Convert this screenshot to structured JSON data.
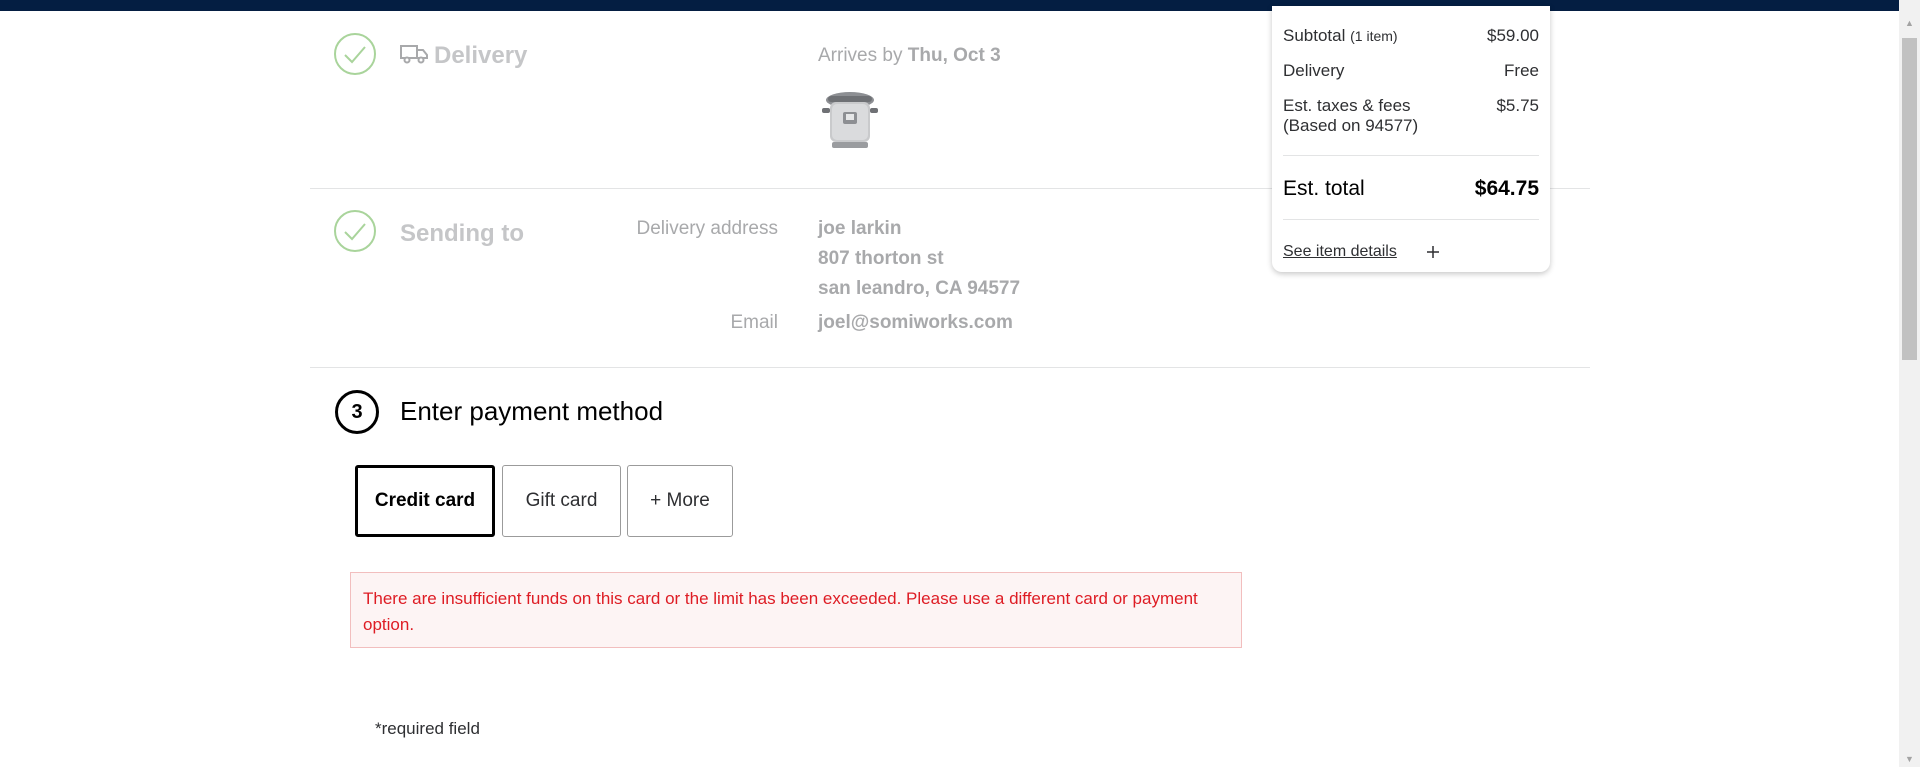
{
  "delivery": {
    "title": "Delivery",
    "arrives_prefix": "Arrives by",
    "arrives_date": "Thu, Oct 3"
  },
  "sending_to": {
    "title": "Sending to",
    "address_label": "Delivery address",
    "address_lines": [
      "joe larkin",
      "807 thorton st",
      "san leandro, CA 94577"
    ],
    "email_label": "Email",
    "email_value": "joel@somiworks.com"
  },
  "payment": {
    "step_number": "3",
    "title": "Enter payment method",
    "tabs": [
      {
        "label": "Credit card",
        "active": true
      },
      {
        "label": "Gift card",
        "active": false
      },
      {
        "label": "+ More",
        "active": false
      }
    ],
    "error_message": "There are insufficient funds on this card or the limit has been exceeded. Please use a different card or payment option.",
    "required_note": "*required field"
  },
  "summary": {
    "subtotal_label": "Subtotal",
    "subtotal_count": "(1 item)",
    "subtotal_value": "$59.00",
    "delivery_label": "Delivery",
    "delivery_value": "Free",
    "taxes_label": "Est. taxes & fees",
    "taxes_sub": "(Based on 94577)",
    "taxes_value": "$5.75",
    "total_label": "Est. total",
    "total_value": "$64.75",
    "details_link": "See item details"
  },
  "icons": {
    "check": "check-icon",
    "truck": "truck-icon",
    "plus": "plus-icon"
  },
  "colors": {
    "header": "#041e42",
    "check_green": "#a9d49b",
    "error_red": "#de1c24",
    "error_bg": "#fdf4f4"
  }
}
